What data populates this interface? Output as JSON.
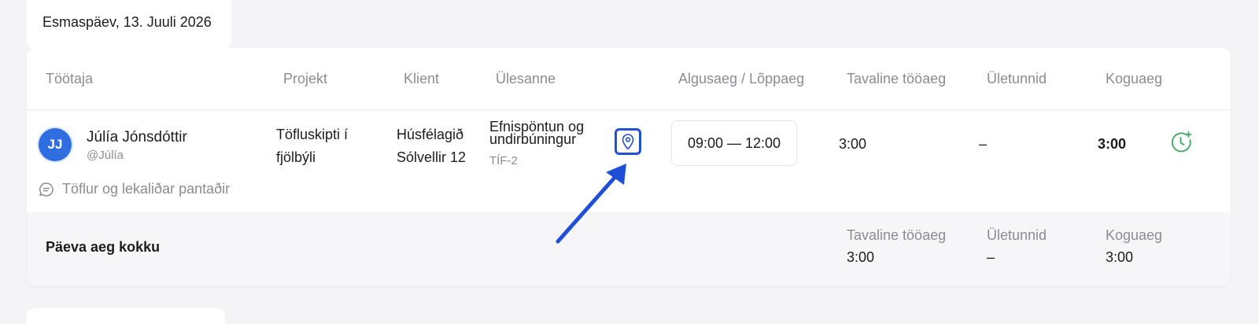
{
  "date_tab": {
    "label": "Esmaspäev, 13. Juuli 2026"
  },
  "columns": {
    "employee": "Töötaja",
    "project": "Projekt",
    "client": "Klient",
    "task": "Ülesanne",
    "time_range": "Algusaeg / Lõppaeg",
    "regular": "Tavaline tööaeg",
    "overtime": "Ületunnid",
    "total": "Koguaeg"
  },
  "entry": {
    "avatar_initials": "JJ",
    "employee_name": "Júlía Jónsdóttir",
    "employee_handle": "@Júlía",
    "project": "Töfluskipti í fjölbýli",
    "client": "Húsfélagið Sólvellir 12",
    "task_name": "Efnispöntun og undirbúningur",
    "task_code": "TÍF-2",
    "time_range": "09:00 — 12:00",
    "regular": "3:00",
    "overtime": "–",
    "total": "3:00",
    "comment": "Töflur og lekaliðar pantaðir"
  },
  "summary": {
    "label": "Päeva aeg kokku",
    "regular_label": "Tavaline tööaeg",
    "regular_value": "3:00",
    "overtime_label": "Ületunnid",
    "overtime_value": "–",
    "total_label": "Koguaeg",
    "total_value": "3:00"
  },
  "colors": {
    "accent_blue": "#1f4fd6",
    "avatar_blue": "#2f6ee0",
    "add_time_green": "#3aa85a",
    "muted_text": "#8b8b92"
  },
  "icons": {
    "location": "map-pin-icon",
    "add_time": "clock-plus-icon",
    "comment": "chat-bubble-icon"
  }
}
